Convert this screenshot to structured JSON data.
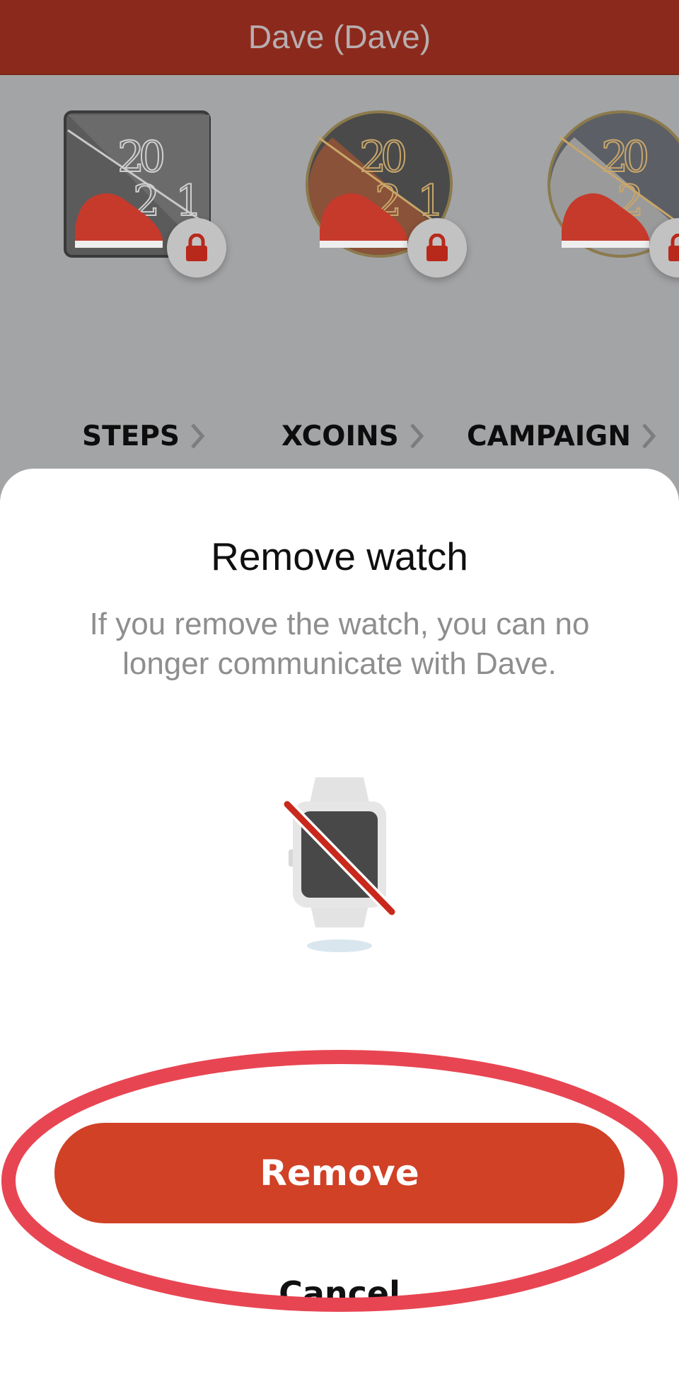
{
  "header": {
    "title": "Dave (Dave)"
  },
  "badges": [
    {
      "name": "steps-badge-square",
      "locked": true
    },
    {
      "name": "steps-badge-bronze",
      "locked": true
    },
    {
      "name": "steps-badge-silver",
      "locked": true
    }
  ],
  "tabs": [
    {
      "label": "STEPS"
    },
    {
      "label": "XCOINS"
    },
    {
      "label": "CAMPAIGN"
    }
  ],
  "dialog": {
    "title": "Remove watch",
    "description": "If you remove the watch, you can no longer communicate with Dave.",
    "icon": "watch-removed-icon",
    "primary_label": "Remove",
    "secondary_label": "Cancel"
  },
  "colors": {
    "header_bg": "#8b2a1c",
    "accent": "#d04126",
    "annotation": "#e84552",
    "lock": "#b8291c"
  }
}
